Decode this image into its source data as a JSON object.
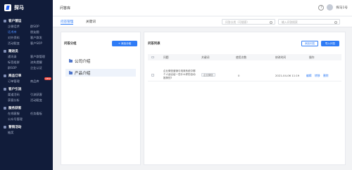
{
  "brand": {
    "name": "探马"
  },
  "header": {
    "title": "问答库",
    "help": "?",
    "user_name": "探马1号"
  },
  "sidebar": {
    "groups": [
      {
        "title": "客户营运",
        "items": [
          "企微话术",
          "群SOP",
          "话术库",
          "朋友圈",
          "对外资料",
          "客户群发",
          "活动裂变",
          "客户SOP"
        ]
      },
      {
        "title": "跟进员",
        "items": [
          "通讯录",
          "客户群管理",
          "标签组群",
          "流失提醒",
          "群SOP",
          "企业认证"
        ]
      },
      {
        "title": "商品订单",
        "items": [
          "订单管理",
          "商品库"
        ]
      },
      {
        "title": "客户引流",
        "items": [
          "渠道活码",
          "引流获客",
          "获客分析",
          "活动裂变"
        ]
      },
      {
        "title": "服务获客",
        "items": [
          "在线客服",
          "任务看板",
          "公众号管理"
        ]
      },
      {
        "title": "营销活动",
        "items": [
          "抽奖"
        ]
      }
    ],
    "new_badge": "NEW"
  },
  "tabs": [
    {
      "label": "问答管理"
    },
    {
      "label": "关键词"
    }
  ],
  "search": {
    "category_placeholder": "问答分类（可搜索）",
    "keyword_placeholder": "输入问答搜索"
  },
  "left_panel": {
    "title": "问答分组",
    "add_button": "+ 添加分组",
    "folders": [
      {
        "label": "公司介绍"
      },
      {
        "label": "产品介绍"
      }
    ]
  },
  "right_panel": {
    "title": "问答列表",
    "add_button": "添加问答",
    "import_button": "导入问答",
    "columns": [
      "问题",
      "关键词",
      "使用次数",
      "修改时间",
      "操作"
    ],
    "rows": [
      {
        "question": "企业微信营销与电商系统中哪个人适合给一些什么样的自动推荐的?",
        "keyword": "企业微信",
        "uses": "0",
        "modified": "2021-04-06 11:19",
        "actions": [
          "编辑",
          "转移",
          "删除"
        ]
      }
    ]
  }
}
